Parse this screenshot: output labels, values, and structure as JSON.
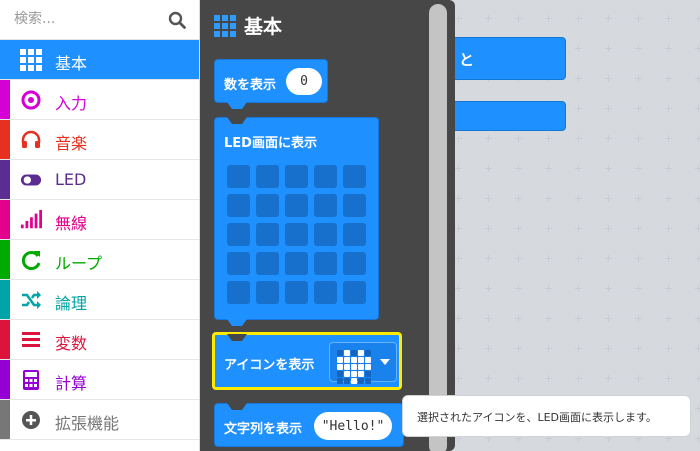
{
  "search": {
    "placeholder": "検索..."
  },
  "categories": [
    {
      "label": "基本",
      "color": "#1e90ff",
      "icon": "grid-icon",
      "selected": true
    },
    {
      "label": "入力",
      "color": "#d400d4",
      "icon": "circle-dot-icon"
    },
    {
      "label": "音楽",
      "color": "#e63022",
      "icon": "headphones-icon"
    },
    {
      "label": "LED",
      "color": "#5c2d91",
      "icon": "toggle-icon"
    },
    {
      "label": "無線",
      "color": "#e3008c",
      "icon": "signal-bars-icon"
    },
    {
      "label": "ループ",
      "color": "#00aa00",
      "icon": "loop-arrow-icon"
    },
    {
      "label": "論理",
      "color": "#00a4a6",
      "icon": "shuffle-icon"
    },
    {
      "label": "変数",
      "color": "#dc143c",
      "icon": "lines-icon"
    },
    {
      "label": "計算",
      "color": "#9400d3",
      "icon": "calculator-icon"
    },
    {
      "label": "拡張機能",
      "color": "#777777",
      "icon": "plus-circle-icon"
    }
  ],
  "flyout": {
    "title": "基本",
    "blocks": [
      {
        "label": "数を表示",
        "value": "0"
      },
      {
        "label": "LED画面に表示"
      },
      {
        "label": "アイコンを表示"
      },
      {
        "label": "文字列を表示",
        "value": "\"Hello!\""
      }
    ]
  },
  "workspace": {
    "block_label": "と"
  },
  "tooltip": {
    "text": "選択されたアイコンを、LED画面に表示します。"
  },
  "colors": {
    "accent": "#1e90ff",
    "flyout_bg": "#474747",
    "highlight": "#ffea00"
  }
}
